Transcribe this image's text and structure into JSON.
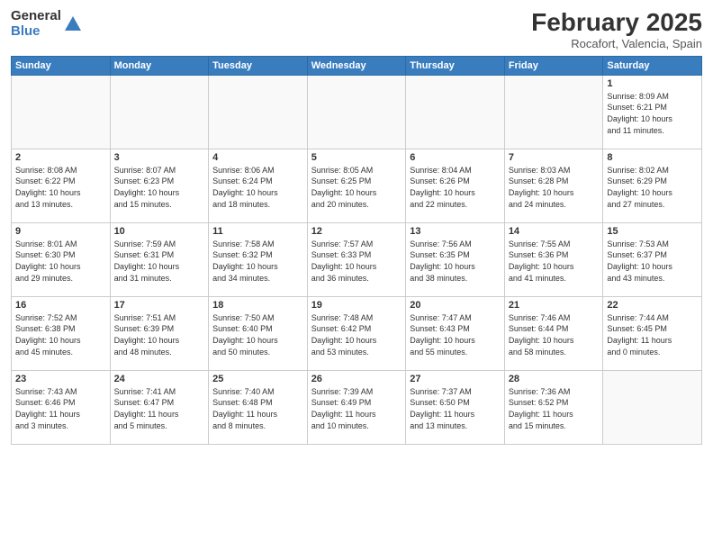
{
  "logo": {
    "general": "General",
    "blue": "Blue"
  },
  "title": "February 2025",
  "location": "Rocafort, Valencia, Spain",
  "days_of_week": [
    "Sunday",
    "Monday",
    "Tuesday",
    "Wednesday",
    "Thursday",
    "Friday",
    "Saturday"
  ],
  "weeks": [
    [
      {
        "day": "",
        "info": ""
      },
      {
        "day": "",
        "info": ""
      },
      {
        "day": "",
        "info": ""
      },
      {
        "day": "",
        "info": ""
      },
      {
        "day": "",
        "info": ""
      },
      {
        "day": "",
        "info": ""
      },
      {
        "day": "1",
        "info": "Sunrise: 8:09 AM\nSunset: 6:21 PM\nDaylight: 10 hours\nand 11 minutes."
      }
    ],
    [
      {
        "day": "2",
        "info": "Sunrise: 8:08 AM\nSunset: 6:22 PM\nDaylight: 10 hours\nand 13 minutes."
      },
      {
        "day": "3",
        "info": "Sunrise: 8:07 AM\nSunset: 6:23 PM\nDaylight: 10 hours\nand 15 minutes."
      },
      {
        "day": "4",
        "info": "Sunrise: 8:06 AM\nSunset: 6:24 PM\nDaylight: 10 hours\nand 18 minutes."
      },
      {
        "day": "5",
        "info": "Sunrise: 8:05 AM\nSunset: 6:25 PM\nDaylight: 10 hours\nand 20 minutes."
      },
      {
        "day": "6",
        "info": "Sunrise: 8:04 AM\nSunset: 6:26 PM\nDaylight: 10 hours\nand 22 minutes."
      },
      {
        "day": "7",
        "info": "Sunrise: 8:03 AM\nSunset: 6:28 PM\nDaylight: 10 hours\nand 24 minutes."
      },
      {
        "day": "8",
        "info": "Sunrise: 8:02 AM\nSunset: 6:29 PM\nDaylight: 10 hours\nand 27 minutes."
      }
    ],
    [
      {
        "day": "9",
        "info": "Sunrise: 8:01 AM\nSunset: 6:30 PM\nDaylight: 10 hours\nand 29 minutes."
      },
      {
        "day": "10",
        "info": "Sunrise: 7:59 AM\nSunset: 6:31 PM\nDaylight: 10 hours\nand 31 minutes."
      },
      {
        "day": "11",
        "info": "Sunrise: 7:58 AM\nSunset: 6:32 PM\nDaylight: 10 hours\nand 34 minutes."
      },
      {
        "day": "12",
        "info": "Sunrise: 7:57 AM\nSunset: 6:33 PM\nDaylight: 10 hours\nand 36 minutes."
      },
      {
        "day": "13",
        "info": "Sunrise: 7:56 AM\nSunset: 6:35 PM\nDaylight: 10 hours\nand 38 minutes."
      },
      {
        "day": "14",
        "info": "Sunrise: 7:55 AM\nSunset: 6:36 PM\nDaylight: 10 hours\nand 41 minutes."
      },
      {
        "day": "15",
        "info": "Sunrise: 7:53 AM\nSunset: 6:37 PM\nDaylight: 10 hours\nand 43 minutes."
      }
    ],
    [
      {
        "day": "16",
        "info": "Sunrise: 7:52 AM\nSunset: 6:38 PM\nDaylight: 10 hours\nand 45 minutes."
      },
      {
        "day": "17",
        "info": "Sunrise: 7:51 AM\nSunset: 6:39 PM\nDaylight: 10 hours\nand 48 minutes."
      },
      {
        "day": "18",
        "info": "Sunrise: 7:50 AM\nSunset: 6:40 PM\nDaylight: 10 hours\nand 50 minutes."
      },
      {
        "day": "19",
        "info": "Sunrise: 7:48 AM\nSunset: 6:42 PM\nDaylight: 10 hours\nand 53 minutes."
      },
      {
        "day": "20",
        "info": "Sunrise: 7:47 AM\nSunset: 6:43 PM\nDaylight: 10 hours\nand 55 minutes."
      },
      {
        "day": "21",
        "info": "Sunrise: 7:46 AM\nSunset: 6:44 PM\nDaylight: 10 hours\nand 58 minutes."
      },
      {
        "day": "22",
        "info": "Sunrise: 7:44 AM\nSunset: 6:45 PM\nDaylight: 11 hours\nand 0 minutes."
      }
    ],
    [
      {
        "day": "23",
        "info": "Sunrise: 7:43 AM\nSunset: 6:46 PM\nDaylight: 11 hours\nand 3 minutes."
      },
      {
        "day": "24",
        "info": "Sunrise: 7:41 AM\nSunset: 6:47 PM\nDaylight: 11 hours\nand 5 minutes."
      },
      {
        "day": "25",
        "info": "Sunrise: 7:40 AM\nSunset: 6:48 PM\nDaylight: 11 hours\nand 8 minutes."
      },
      {
        "day": "26",
        "info": "Sunrise: 7:39 AM\nSunset: 6:49 PM\nDaylight: 11 hours\nand 10 minutes."
      },
      {
        "day": "27",
        "info": "Sunrise: 7:37 AM\nSunset: 6:50 PM\nDaylight: 11 hours\nand 13 minutes."
      },
      {
        "day": "28",
        "info": "Sunrise: 7:36 AM\nSunset: 6:52 PM\nDaylight: 11 hours\nand 15 minutes."
      },
      {
        "day": "",
        "info": ""
      }
    ]
  ]
}
